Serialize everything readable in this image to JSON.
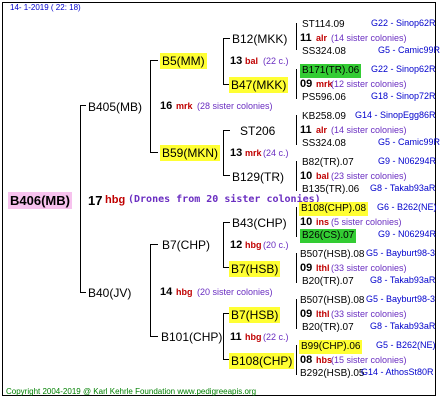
{
  "header": {
    "date": "14-  1-2019 ( 22: 18)"
  },
  "footer": {
    "copyright": "Copyright 2004-2019 @ Karl Kehrle Foundation    www.pedigreeapis.org"
  },
  "root": {
    "name": "B406(MB)",
    "num": "17",
    "code": "hbg",
    "note": "(Drones from 20 sister colonies)"
  },
  "gen1": [
    {
      "name": "B405(MB)",
      "num": "16",
      "code": "mrk",
      "note": "(28 sister colonies)"
    },
    {
      "name": "B40(JV)",
      "num": "14",
      "code": "hbg",
      "note": "(20 sister colonies)"
    }
  ],
  "gen2": [
    {
      "name": "B5(MM)",
      "num": "13",
      "code": "bal",
      "note": "(22 c.)"
    },
    {
      "name": "B59(MKN)",
      "num": "13",
      "code": "mrk",
      "note": "(24 c.)"
    },
    {
      "name": "B7(CHP)",
      "num": "12",
      "code": "hbg",
      "note": "(20 c.)"
    },
    {
      "name": "B101(CHP)",
      "num": "11",
      "code": "hbg",
      "note": "(22 c.)"
    }
  ],
  "gen3": [
    {
      "name": "B12(MKK)",
      "num": "11",
      "code": "alr",
      "note": "(14 sister colonies)"
    },
    {
      "name": "B47(MKK)",
      "num": "09",
      "code": "mrk",
      "note": "(12 sister colonies)"
    },
    {
      "name": "ST206",
      "num": "11",
      "code": "alr",
      "note": "(14 sister colonies)"
    },
    {
      "name": "B129(TR)",
      "num": "10",
      "code": "bal",
      "note": "(23 sister colonies)"
    },
    {
      "name": "B43(CHP)",
      "num": "10",
      "code": "ins",
      "note": "(5 sister colonies)"
    },
    {
      "name": "B7(HSB)",
      "num": "09",
      "code": "lthl",
      "note": "(33 sister colonies)"
    },
    {
      "name": "B7(HSB)",
      "num": "09",
      "code": "lthl",
      "note": "(33 sister colonies)"
    },
    {
      "name": "B108(CHP)",
      "num": "08",
      "code": "hbs",
      "note": "(15 sister colonies)"
    }
  ],
  "gen4": [
    {
      "name": "ST114.09",
      "ref": "G22 - Sinop62R"
    },
    {
      "name": "SS324.08",
      "ref": "G5 - Camic99R"
    },
    {
      "name": "B171(TR).06",
      "ref": "G22 - Sinop62R"
    },
    {
      "name": "PS596.06",
      "ref": "G18 - Sinop72R"
    },
    {
      "name": "KB258.09",
      "ref": "G14 - SinopEgg86R"
    },
    {
      "name": "SS324.08",
      "ref": "G5 - Camic99R"
    },
    {
      "name": "B82(TR).07",
      "ref": "G9 - N06294R"
    },
    {
      "name": "B135(TR).06",
      "ref": "G8 - Takab93aR"
    },
    {
      "name": "B108(CHP).08",
      "ref": "G6 - B262(NE)"
    },
    {
      "name": "B26(CS).07",
      "ref": "G9 - N06294R"
    },
    {
      "name": "B507(HSB).08",
      "ref": "G5 - Bayburt98-3"
    },
    {
      "name": "B20(TR).07",
      "ref": "G8 - Takab93aR"
    },
    {
      "name": "B507(HSB).08",
      "ref": "G5 - Bayburt98-3"
    },
    {
      "name": "B20(TR).07",
      "ref": "G8 - Takab93aR"
    },
    {
      "name": "B99(CHP).06",
      "ref": "G5 - B262(NE)"
    },
    {
      "name": "B292(HSB).05",
      "ref": "G14 - AthosSt80R"
    }
  ]
}
